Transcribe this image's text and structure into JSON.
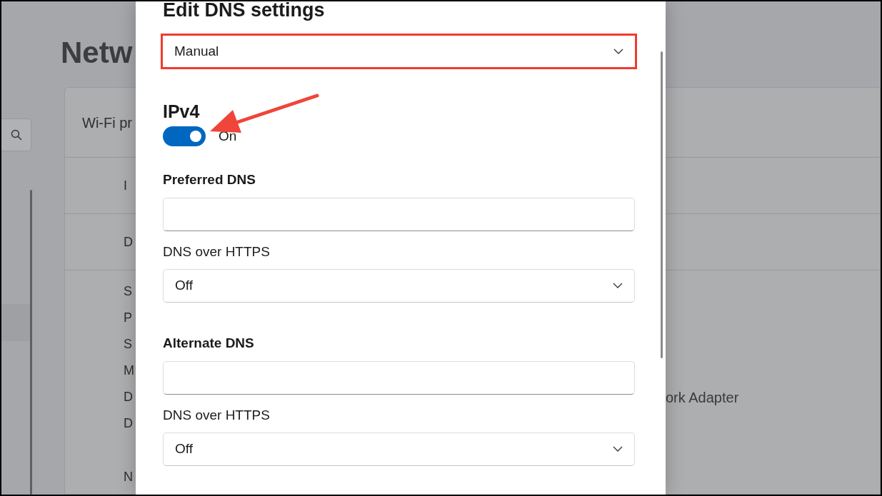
{
  "background": {
    "page_title": "Netw",
    "card": {
      "header": "Wi-Fi pr",
      "rows": [
        "I",
        "D"
      ],
      "properties": [
        {
          "label": "S"
        },
        {
          "label": "P"
        },
        {
          "label": "S"
        },
        {
          "label": "M"
        },
        {
          "label": "D",
          "value": "ork Adapter"
        },
        {
          "label": "D"
        }
      ],
      "last_label": "N"
    }
  },
  "dialog": {
    "title": "Edit DNS settings",
    "mode": {
      "value": "Manual",
      "highlighted": true
    },
    "ipv4": {
      "heading": "IPv4",
      "toggle": {
        "on": true,
        "label": "On"
      },
      "sections": [
        {
          "heading": "Preferred DNS",
          "encryption_label": "DNS over HTTPS",
          "encryption_value": "Off"
        },
        {
          "heading": "Alternate DNS",
          "encryption_label": "DNS over HTTPS",
          "encryption_value": "Off"
        }
      ]
    }
  }
}
